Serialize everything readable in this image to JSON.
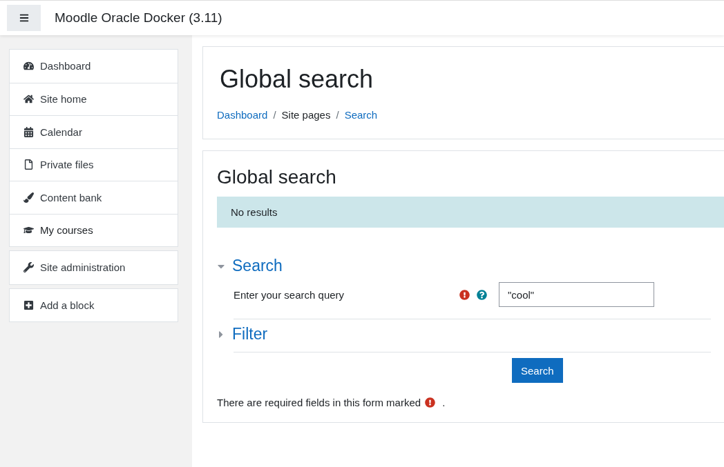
{
  "header": {
    "site_name": "Moodle Oracle Docker (3.11)"
  },
  "sidebar": {
    "groups": [
      {
        "items": [
          {
            "label": "Dashboard",
            "kind": "link"
          },
          {
            "label": "Site home",
            "kind": "link"
          },
          {
            "label": "Calendar",
            "kind": "link"
          },
          {
            "label": "Private files",
            "kind": "link"
          },
          {
            "label": "Content bank",
            "kind": "link"
          },
          {
            "label": "My courses",
            "kind": "heading"
          }
        ]
      },
      {
        "items": [
          {
            "label": "Site administration",
            "kind": "link"
          }
        ]
      },
      {
        "items": [
          {
            "label": "Add a block",
            "kind": "link"
          }
        ]
      }
    ]
  },
  "page_header": {
    "title": "Global search",
    "breadcrumb": [
      {
        "label": "Dashboard",
        "link": true
      },
      {
        "separator": "/",
        "label": "Site pages",
        "link": false
      },
      {
        "separator": "/",
        "label": "Search",
        "link": true
      }
    ]
  },
  "content": {
    "title": "Global search",
    "alert": "No results",
    "sections": [
      {
        "title": "Search",
        "expanded": true,
        "fields": [
          {
            "label": "Enter your search query",
            "required": true,
            "help": true,
            "value": "\"cool\""
          }
        ]
      },
      {
        "title": "Filter",
        "expanded": false
      }
    ],
    "submit": "Search",
    "required_note": "There are required fields in this form marked",
    "required_note_end": "."
  }
}
